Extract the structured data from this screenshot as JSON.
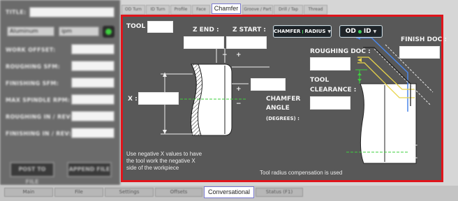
{
  "window": {
    "active_top_tab": "Chamfer",
    "active_bottom_tab": "Conversational"
  },
  "top_tabs": [
    "OD Turn",
    "ID Turn",
    "Profile",
    "Face",
    "Chamfer",
    "Groove / Part",
    "Drill / Tap",
    "Thread"
  ],
  "bottom_tabs": [
    "Main",
    "File",
    "Settings",
    "Offsets",
    "Conversational",
    "Status (F1)"
  ],
  "left_panel": {
    "title_label": "TITLE:",
    "title_value": "",
    "material": "Aluminum",
    "units": "ipm",
    "fields": [
      {
        "label": "WORK OFFSET:",
        "value": ""
      },
      {
        "label": "ROUGHING SFM:",
        "value": ""
      },
      {
        "label": "FINISHING SFM:",
        "value": ""
      },
      {
        "label": "MAX SPINDLE RPM:",
        "value": ""
      },
      {
        "label": "ROUGHING IN / REV:",
        "value": ""
      },
      {
        "label": "FINISHING IN / REV:",
        "value": ""
      }
    ],
    "post_button": "POST TO FILE",
    "append_button": "APPEND FILE"
  },
  "chamfer": {
    "tool_label": "TOOL :",
    "tool_value": "",
    "z_end_label": "Z END :",
    "z_end_value": "",
    "z_start_label": "Z START :",
    "z_start_value": "",
    "x_label": "X :",
    "x_value": "",
    "chamfer_angle_label_1": "CHAMFER",
    "chamfer_angle_label_2": "ANGLE",
    "chamfer_angle_units": "(DEGREES) :",
    "chamfer_angle_value": "",
    "mode_toggle": {
      "left": "CHAMFER",
      "right": "RADIUS"
    },
    "side_toggle": {
      "left": "OD",
      "right": "ID"
    },
    "roughing_doc_label": "ROUGHING DOC :",
    "roughing_doc_value": "",
    "finish_doc_label": "FINISH DOC :",
    "finish_doc_value": "",
    "tool_clearance_label_1": "TOOL",
    "tool_clearance_label_2": "CLEARANCE :",
    "tool_clearance_value": "",
    "note_negative_x": "Use negative X values to have the tool work the negative X side of the workpiece",
    "note_radius_comp": "Tool radius compensation is used",
    "plus_sign": "+",
    "minus_sign": "−",
    "colors": {
      "frame": "#e0141b",
      "panel": "#585858",
      "blue_path": "#4a86e8",
      "yellow_path": "#e8d44a",
      "green_path": "#3ecf3e",
      "led": "#3fd05a"
    }
  }
}
